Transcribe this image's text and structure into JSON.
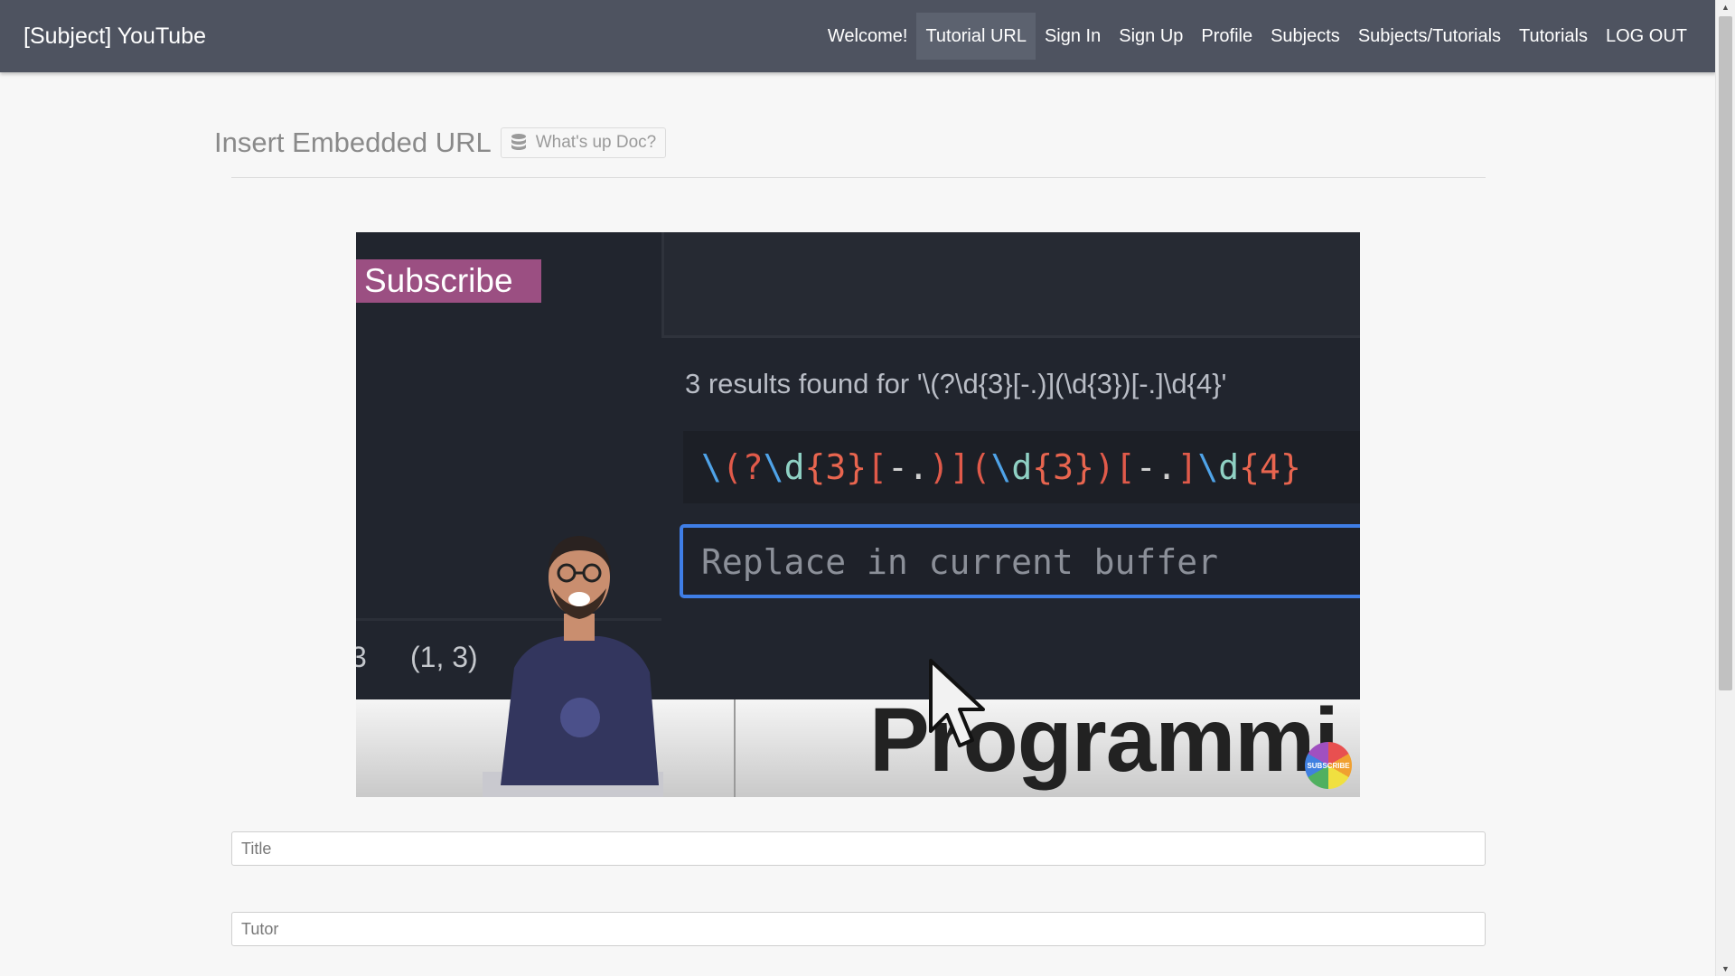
{
  "navbar": {
    "brand": "[Subject] YouTube",
    "items": [
      {
        "label": "Welcome!"
      },
      {
        "label": "Tutorial URL",
        "active": true
      },
      {
        "label": "Sign In"
      },
      {
        "label": "Sign Up"
      },
      {
        "label": "Profile"
      },
      {
        "label": "Subjects"
      },
      {
        "label": "Subjects/Tutorials"
      },
      {
        "label": "Tutorials"
      },
      {
        "label": "LOG OUT"
      }
    ]
  },
  "page": {
    "title": "Insert Embedded URL",
    "doc_button": {
      "label": "What's up Doc?",
      "icon": "database-icon"
    }
  },
  "video": {
    "subscribe_overlay": "Subscribe",
    "results_text": "3 results found for '\\(?\\d{3}[-.)](\\d{3})[-.]\\d{4}'",
    "regex": "\\(?\\d{3}[-.)](\\d{3})[-.]\\d{4}",
    "replace_placeholder": "Replace in current buffer",
    "coordinate_edge": "3",
    "coordinate": "(1, 3)",
    "bottom_text": "Programmi",
    "badge_label": "SUBSCRIBE"
  },
  "form": {
    "title_placeholder": "Title",
    "tutor_placeholder": "Tutor"
  },
  "colors": {
    "navbar_bg": "#4e5360",
    "active_nav_bg": "#5c626f",
    "page_bg": "#f7f7f7",
    "subscribe_bg": "#9b4f82",
    "replace_border": "#3f7ee6"
  }
}
